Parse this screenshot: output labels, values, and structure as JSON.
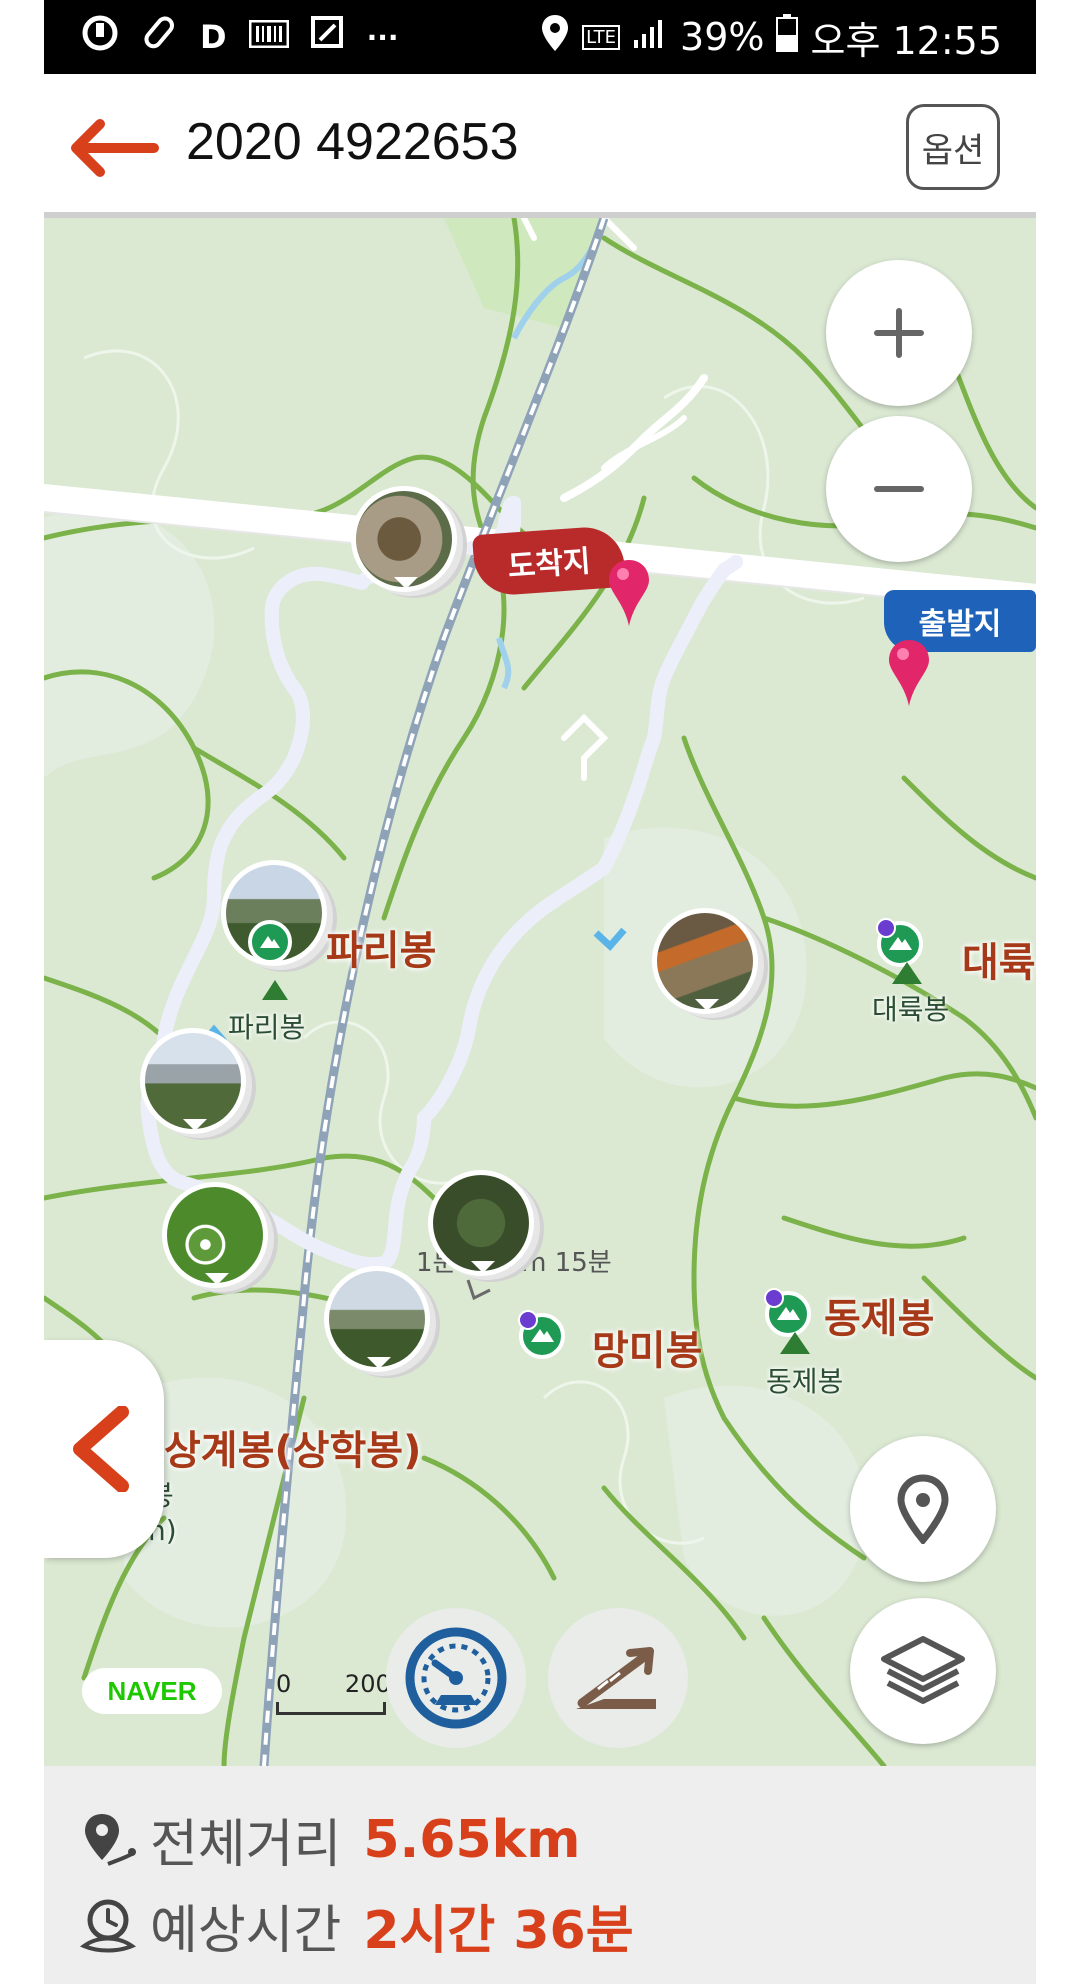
{
  "status_bar": {
    "icons": [
      "carrier-icon",
      "pill-icon",
      "d-icon",
      "barcode-icon",
      "edit-icon",
      "more-icon",
      "location-icon",
      "lte-icon",
      "signal-icon",
      "battery-icon"
    ],
    "d_letter": "D",
    "more": "···",
    "network": "LTE",
    "battery": "39%",
    "time": "오후 12:55"
  },
  "header": {
    "title": "2020 4922653",
    "options_label": "옵션",
    "accent_color": "#d8401b"
  },
  "map": {
    "end_flag": "도착지",
    "start_flag": "출발지",
    "peaks": {
      "pari_big": "파리봉",
      "pari_small": "파리봉",
      "daeryuk_big": "대륙",
      "daeryuk_small": "대륙봉",
      "mangmi_big": "망미봉",
      "dongje_big": "동제봉",
      "dongje_small": "동제봉",
      "sanggye_big": "상계봉(상학봉)",
      "sanggye_small_1": "봉",
      "sanggye_small_2": "n)"
    },
    "route_note": "1분 0.9km 15분",
    "naver_label": "NAVER",
    "scale_zero": "0",
    "scale_value": "200",
    "route_color": "#2a2fd0",
    "buttons": [
      "zoom-in",
      "zoom-out",
      "my-location",
      "layers",
      "speedometer",
      "elevation"
    ]
  },
  "info": {
    "distance_label": "전체거리",
    "distance_value": "5.65km",
    "time_label": "예상시간",
    "time_value": "2시간 36분"
  }
}
